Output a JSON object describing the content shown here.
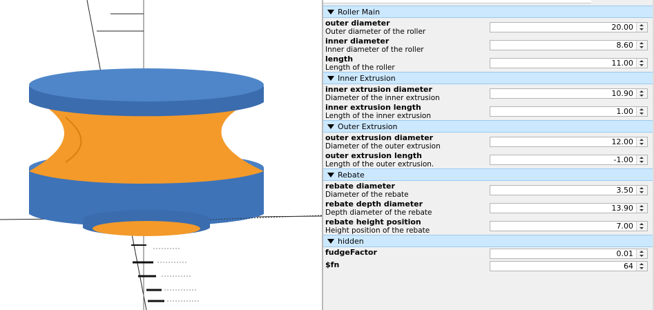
{
  "colors": {
    "model_blue": "#3e73b8",
    "model_orange": "#f39a2a",
    "header_bg": "#cce8ff",
    "panel_bg": "#f0f0f0"
  },
  "sections": [
    {
      "title": "Roller Main",
      "params": [
        {
          "name": "outer diameter",
          "desc": "Outer diameter of the roller",
          "value": "20.00"
        },
        {
          "name": "inner diameter",
          "desc": "Inner diameter of the roller",
          "value": "8.60"
        },
        {
          "name": "length",
          "desc": "Length of the roller",
          "value": "11.00"
        }
      ]
    },
    {
      "title": "Inner Extrusion",
      "params": [
        {
          "name": "inner extrusion diameter",
          "desc": "Diameter of the inner extrusion",
          "value": "10.90"
        },
        {
          "name": "inner extrusion length",
          "desc": "Length of the inner extrusion",
          "value": "1.00"
        }
      ]
    },
    {
      "title": "Outer Extrusion",
      "params": [
        {
          "name": "outer extrusion diameter",
          "desc": "Diameter of the outer extrusion",
          "value": "12.00"
        },
        {
          "name": "outer extrusion length",
          "desc": "Length of the outer extrusion.",
          "value": "-1.00"
        }
      ]
    },
    {
      "title": "Rebate",
      "params": [
        {
          "name": "rebate diameter",
          "desc": "Diameter of the rebate",
          "value": "3.50"
        },
        {
          "name": "rebate depth diameter",
          "desc": "Depth diameter of the rebate",
          "value": "13.90"
        },
        {
          "name": "rebate height position",
          "desc": "Height position of the rebate",
          "value": "7.00"
        }
      ]
    },
    {
      "title": "hidden",
      "params": [
        {
          "name": "fudgeFactor",
          "desc": "",
          "value": "0.01"
        },
        {
          "name": "$fn",
          "desc": "",
          "value": "64"
        }
      ]
    }
  ]
}
